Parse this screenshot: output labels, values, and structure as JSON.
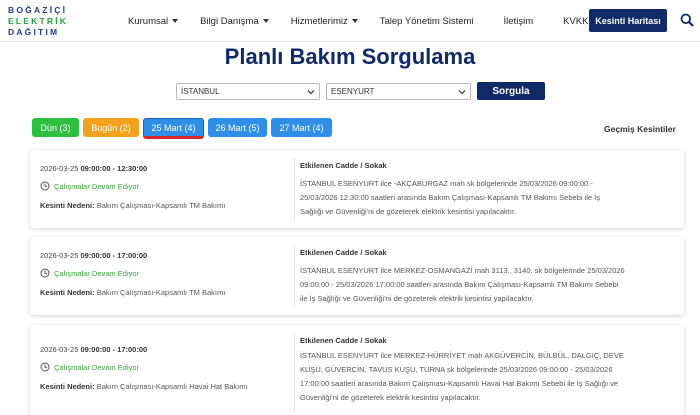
{
  "logo": {
    "line1": "BOĞAZİÇİ",
    "line2": "ELEKTRİK",
    "line3": "DAĞITIM"
  },
  "nav": [
    {
      "label": "Kurumsal",
      "dropdown": true
    },
    {
      "label": "Bilgi Danışma",
      "dropdown": true
    },
    {
      "label": "Hizmetlerimiz",
      "dropdown": true
    },
    {
      "label": "Talep Yönetim Sistemi",
      "dropdown": false
    },
    {
      "label": "İletişim",
      "dropdown": false
    },
    {
      "label": "KVKK",
      "dropdown": true
    }
  ],
  "outage_map_label": "Kesinti Haritası",
  "page_title": "Planlı Bakım Sorgulama",
  "filters": {
    "city": "İSTANBUL",
    "district": "ESENYURT",
    "query_label": "Sorgula"
  },
  "tabs": [
    {
      "label": "Dün (3)",
      "color": "#2fbf3f"
    },
    {
      "label": "Bugün (2)",
      "color": "#f4a21d"
    },
    {
      "label": "25 Mart (4)",
      "color": "#2f8fe8",
      "active": true
    },
    {
      "label": "26 Mart (5)",
      "color": "#2f8fe8"
    },
    {
      "label": "27 Mart (4)",
      "color": "#2f8fe8"
    }
  ],
  "past_outages_label": "Geçmiş Kesintiler",
  "labels": {
    "street_header": "Etkilenen Cadde / Sokak",
    "reason_prefix": "Kesinti Nedeni:",
    "status": "Çalışmalar Devam Ediyor"
  },
  "outages": [
    {
      "date": "2026-03-25",
      "time": "09:00:00 - 12:30:00",
      "reason": "Bakım Çalışması-Kapsamlı TM Bakımı",
      "desc_lines": [
        "İSTANBUL ESENYURT ilce -AKÇABURGAZ mah sk bölgelerinde 25/03/2026 09:00:00 -",
        "25/03/2026 12:30:00 saatleri arasında Bakım Çalışması-Kapsamlı TM Bakımı Sebebi ile İş",
        "Sağlığı ve Güvenliği'ni de gözeterek elektrik kesintisi yapılacaktır."
      ]
    },
    {
      "date": "2026-03-25",
      "time": "09:00:00 - 17:00:00",
      "reason": "Bakım Çalışması-Kapsamlı TM Bakımı",
      "desc_lines": [
        "İSTANBUL ESENYURT ilce MERKEZ-OSMANGAZİ mah 3113., 3140. sk bölgelerinde 25/03/2026",
        "09:00:00 - 25/03/2026 17:00:00 saatleri arasında Bakım Çalışması-Kapsamlı TM Bakımı Sebebi",
        "ile İş Sağlığı ve Güvenliği'ni de gözeterek elektrik kesintisi yapılacaktır."
      ]
    },
    {
      "date": "2026-03-25",
      "time": "09:00:00 - 17:00:00",
      "reason": "Bakım Çalışması-Kapsamlı Havai Hat Bakımı",
      "desc_lines": [
        "İSTANBUL ESENYURT ilce MERKEZ-HÜRRİYET mah AKGÜVERCİN, BÜLBÜL, DALGIÇ, DEVE",
        "KUŞU, GÜVERCİN, TAVUS KUŞU, TURNA sk bölgelerinde 25/03/2026 09:00:00 - 25/03/2026",
        "17:00:00 saatleri arasında Bakım Çalışması-Kapsamlı Havai Hat Bakımı Sebebi ile İş Sağlığı ve",
        "Güvenliği'ni de gözeterek elektrik kesintisi yapılacaktır."
      ]
    }
  ]
}
